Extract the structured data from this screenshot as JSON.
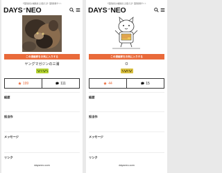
{
  "left": {
    "tagline": "【漫画初出の編集者と出会える】漫画投稿サイト",
    "logo": {
      "part1": "DAYS",
      "of": "of",
      "part2": "NEO"
    },
    "favorite_button": "この漫画家をお気に入りする",
    "author": "ヤングマガジンの三浦",
    "stats": {
      "likes": "199",
      "comments": "111"
    },
    "sections": [
      "経歴",
      "担当作",
      "メッセージ",
      "リンク"
    ],
    "footer_url": "daysneo.com"
  },
  "right": {
    "tagline": "【漫画初出の編集者と出会える】漫画投稿サイト",
    "logo": {
      "part1": "DAYS",
      "of": "of",
      "part2": "NEO"
    },
    "favorite_button": "この漫画家をお気に入りする",
    "author": "O",
    "stats": {
      "likes": "44",
      "comments": "15"
    },
    "sections": [
      "経歴",
      "担当作",
      "メッセージ",
      "リンク"
    ],
    "footer_url": "daysneo.com"
  },
  "colors": {
    "accent": "#e96a3a",
    "panel_bg": "#ffffff",
    "page_bg": "#e9e9e9"
  }
}
